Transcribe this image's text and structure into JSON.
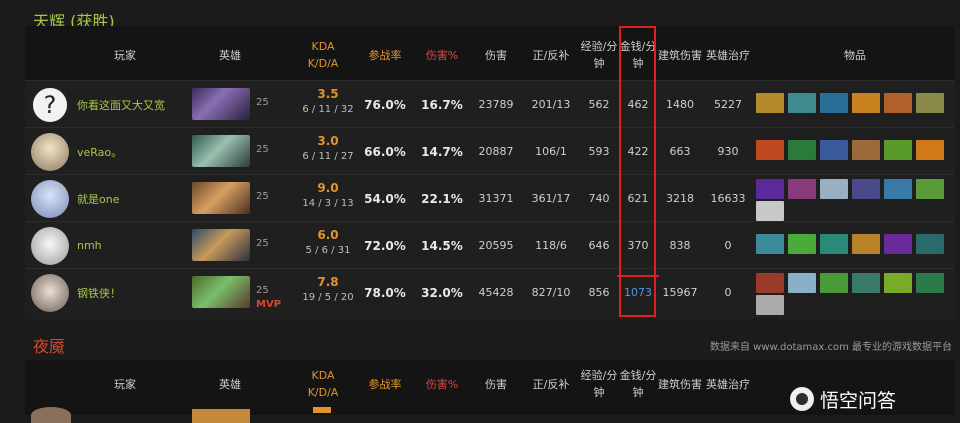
{
  "radiant_title": "天辉 (获胜)",
  "dire_title": "夜魇",
  "headers": {
    "player": "玩家",
    "hero": "英雄",
    "kda": "KDA\nK/D/A",
    "participation": "参战率",
    "damage_pct": "伤害%",
    "damage": "伤害",
    "last_hits": "正/反补",
    "xpm": "经验/分\n钟",
    "gpm": "金钱/分\n钟",
    "building_damage": "建筑伤害",
    "healing": "英雄治疗",
    "items": "物品"
  },
  "rows": [
    {
      "name": "你看这面又大又宽",
      "level": "25",
      "kda": "3.5",
      "kda_detail": "6 / 11 / 32",
      "participation": "76.0%",
      "damage_pct": "16.7%",
      "damage": "23789",
      "last_hits": "201/13",
      "xpm": "562",
      "gpm": "462",
      "building": "1480",
      "healing": "5227",
      "mvp": ""
    },
    {
      "name": "veRao。",
      "level": "25",
      "kda": "3.0",
      "kda_detail": "6 / 11 / 27",
      "participation": "66.0%",
      "damage_pct": "14.7%",
      "damage": "20887",
      "last_hits": "106/1",
      "xpm": "593",
      "gpm": "422",
      "building": "663",
      "healing": "930",
      "mvp": ""
    },
    {
      "name": "就是one",
      "level": "25",
      "kda": "9.0",
      "kda_detail": "14 / 3 / 13",
      "participation": "54.0%",
      "damage_pct": "22.1%",
      "damage": "31371",
      "last_hits": "361/17",
      "xpm": "740",
      "gpm": "621",
      "building": "3218",
      "healing": "16633",
      "mvp": ""
    },
    {
      "name": "nmh",
      "level": "25",
      "kda": "6.0",
      "kda_detail": "5 / 6 / 31",
      "participation": "72.0%",
      "damage_pct": "14.5%",
      "damage": "20595",
      "last_hits": "118/6",
      "xpm": "646",
      "gpm": "370",
      "building": "838",
      "healing": "0",
      "mvp": ""
    },
    {
      "name": "钢铁侠！",
      "level": "25",
      "kda": "7.8",
      "kda_detail": "19 / 5 / 20",
      "participation": "78.0%",
      "damage_pct": "32.0%",
      "damage": "45428",
      "last_hits": "827/10",
      "xpm": "856",
      "gpm": "1073",
      "building": "15967",
      "healing": "0",
      "mvp": "MVP"
    }
  ],
  "avatar_question": "?",
  "footnote": "数据来自 www.dotamax.com 最专业的游戏数据平台",
  "watermark": "悟空问答",
  "colors": {
    "accent_green": "#a7c84a",
    "accent_orange": "#e0942a",
    "dire_red": "#d04a2c",
    "highlight": "#e01e26"
  }
}
